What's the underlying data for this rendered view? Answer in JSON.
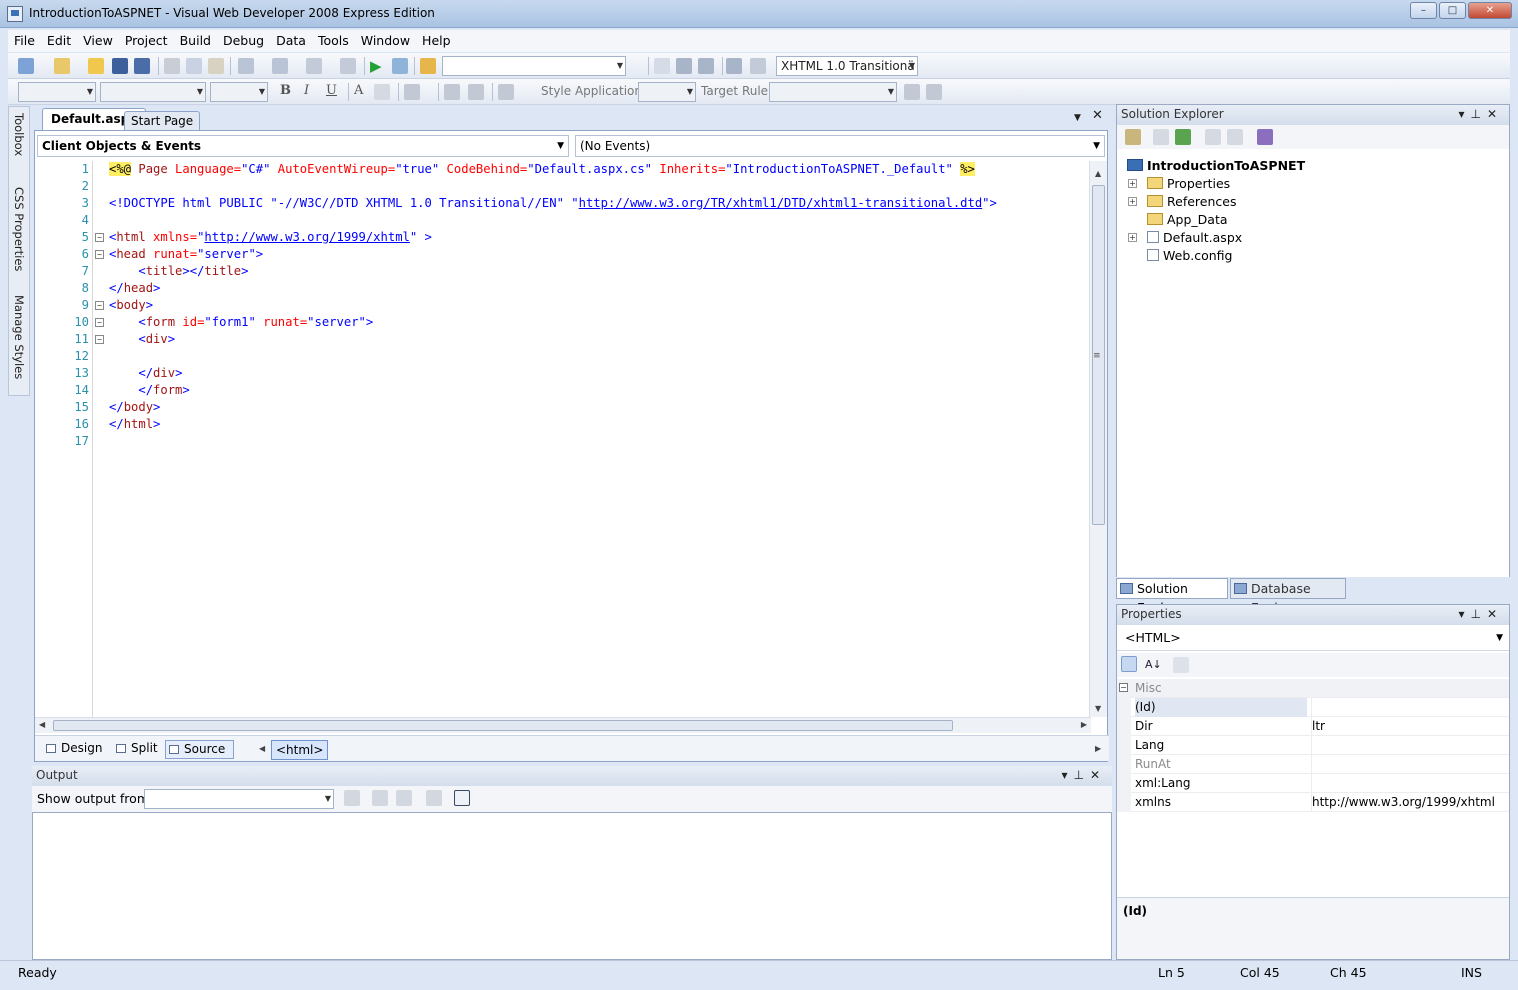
{
  "window": {
    "title": "IntroductionToASPNET - Visual Web Developer 2008 Express Edition"
  },
  "menu": [
    "File",
    "Edit",
    "View",
    "Project",
    "Build",
    "Debug",
    "Data",
    "Tools",
    "Window",
    "Help"
  ],
  "toolbar": {
    "doctype_select": "XHTML 1.0 Transitionä",
    "style_application_label": "Style Application:",
    "target_rule_label": "Target Rule:"
  },
  "side_tabs": [
    "Toolbox",
    "CSS Properties",
    "Manage Styles"
  ],
  "doc_tabs": [
    "Default.aspx",
    "Start Page"
  ],
  "editor": {
    "objects_combo": "Client Objects & Events",
    "events_combo": "(No Events)",
    "line_numbers": [
      "1",
      "2",
      "3",
      "4",
      "5",
      "6",
      "7",
      "8",
      "9",
      "10",
      "11",
      "12",
      "13",
      "14",
      "15",
      "16",
      "17"
    ],
    "lines": {
      "l1": {
        "open": "<%@",
        "page": " Page",
        "lang_attr": " Language=",
        "lang_val": "\"C#\"",
        "wire_attr": " AutoEventWireup=",
        "wire_val": "\"true\"",
        "cb_attr": " CodeBehind=",
        "cb_val": "\"Default.aspx.cs\"",
        "inh_attr": " Inherits=",
        "inh_val": "\"IntroductionToASPNET._Default\"",
        "close": "%>"
      },
      "l3": {
        "doctype": "<!DOCTYPE html PUBLIC \"-//W3C//DTD XHTML 1.0 Transitional//EN\" \"",
        "url": "http://www.w3.org/TR/xhtml1/DTD/xhtml1-transitional.dtd",
        "end": "\">"
      },
      "l5": {
        "open": "<",
        "tag": "html",
        "attr": " xmlns=",
        "q": "\"",
        "url": "http://www.w3.org/1999/xhtml",
        "end": "\" >"
      },
      "l6": {
        "open": "<",
        "tag": "head",
        "attr": " runat=",
        "val": "\"server\"",
        "end": ">"
      },
      "l7": {
        "indent": "    ",
        "o1": "<",
        "t1": "title",
        "c1": "></",
        "t2": "title",
        "c2": ">"
      },
      "l8": {
        "open": "</",
        "tag": "head",
        "end": ">"
      },
      "l9": {
        "open": "<",
        "tag": "body",
        "end": ">"
      },
      "l10": {
        "indent": "    ",
        "open": "<",
        "tag": "form",
        "a1": " id=",
        "v1": "\"form1\"",
        "a2": " runat=",
        "v2": "\"server\"",
        "end": ">"
      },
      "l11": {
        "indent": "    ",
        "open": "<",
        "tag": "div",
        "end": ">"
      },
      "l13": {
        "indent": "    ",
        "open": "</",
        "tag": "div",
        "end": ">"
      },
      "l14": {
        "indent": "    ",
        "open": "</",
        "tag": "form",
        "end": ">"
      },
      "l15": {
        "open": "</",
        "tag": "body",
        "end": ">"
      },
      "l16": {
        "open": "</",
        "tag": "html",
        "end": ">"
      }
    }
  },
  "view_bar": {
    "design": "Design",
    "split": "Split",
    "source": "Source",
    "tag": "<html>"
  },
  "output": {
    "title": "Output",
    "show_from_label": "Show output from:"
  },
  "solution_explorer": {
    "title": "Solution Explorer",
    "project": "IntroductionToASPNET",
    "items": [
      "Properties",
      "References",
      "App_Data",
      "Default.aspx",
      "Web.config"
    ]
  },
  "bottom_tabs": [
    "Solution Explorer",
    "Database Explorer"
  ],
  "properties": {
    "title": "Properties",
    "object": "<HTML>",
    "category": "Misc",
    "rows": [
      {
        "name": "(Id)",
        "value": ""
      },
      {
        "name": "Dir",
        "value": "ltr"
      },
      {
        "name": "Lang",
        "value": ""
      },
      {
        "name": "RunAt",
        "value": ""
      },
      {
        "name": "xml:Lang",
        "value": ""
      },
      {
        "name": "xmlns",
        "value": "http://www.w3.org/1999/xhtml"
      }
    ],
    "description": "(Id)"
  },
  "status": {
    "left": "Ready",
    "ln": "Ln 5",
    "col": "Col 45",
    "ch": "Ch 45",
    "ins": "INS"
  },
  "colors": {
    "tag": "#a31515",
    "attr": "#ff0000",
    "value": "#0000ff",
    "line_number": "#2b91af",
    "directive_bg": "#ffee62"
  }
}
